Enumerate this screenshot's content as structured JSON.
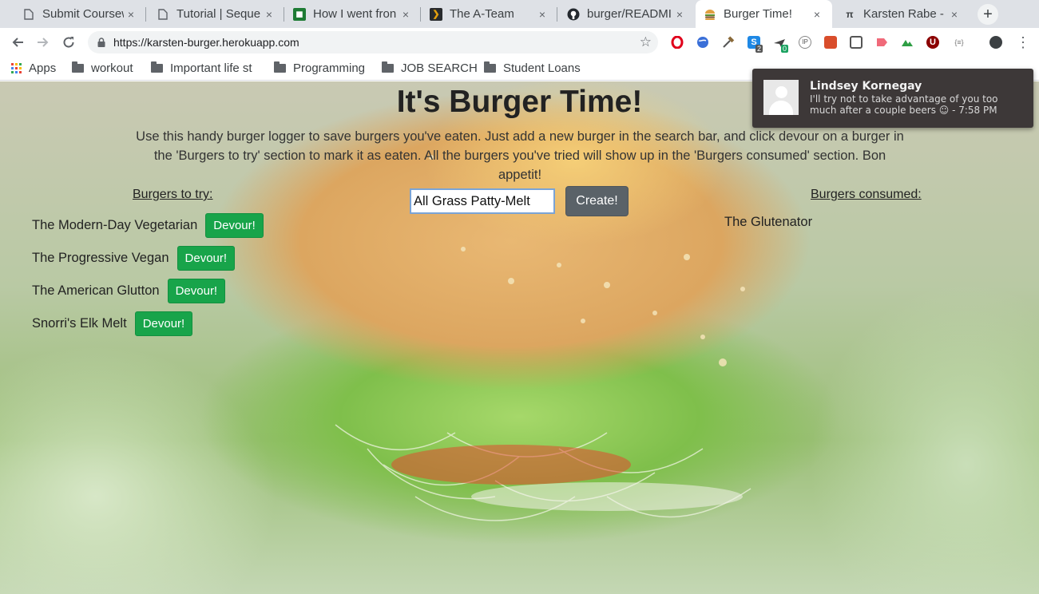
{
  "browser": {
    "tabs": [
      {
        "title": "Submit Coursew",
        "icon": "document-icon",
        "active": false
      },
      {
        "title": "Tutorial | Seque",
        "icon": "document-icon",
        "active": false
      },
      {
        "title": "How I went fron",
        "icon": "site-green-icon",
        "active": false
      },
      {
        "title": "The A-Team",
        "icon": "plex-icon",
        "active": false
      },
      {
        "title": "burger/READMI",
        "icon": "github-icon",
        "active": false
      },
      {
        "title": "Burger Time!",
        "icon": "burger-icon",
        "active": true
      },
      {
        "title": "Karsten Rabe - V",
        "icon": "pi-icon",
        "active": false
      }
    ],
    "tab_close_glyph": "×",
    "new_tab_glyph": "+",
    "url": "https://karsten-burger.herokuapp.com",
    "bookmarks": [
      "Apps",
      "workout",
      "Important life st",
      "Programming",
      "JOB SEARCH",
      "Student Loans"
    ],
    "extension_badges": {
      "s_ext": "2",
      "green_ext": "0",
      "ip_ext": "IP",
      "json_ext": "{≡}"
    }
  },
  "page": {
    "title": "It's Burger Time!",
    "intro": "Use this handy burger logger to save burgers you've eaten. Just add a new burger in the search bar, and click devour on a burger in the 'Burgers to try' section to mark it as eaten. All the burgers you've tried will show up in the 'Burgers consumed' section. Bon appetit!",
    "to_try_heading": "Burgers to try:",
    "consumed_heading": "Burgers consumed:",
    "input_value": "All Grass Patty-Melt",
    "create_label": "Create!",
    "devour_label": "Devour!",
    "to_try": [
      "The Modern-Day Vegetarian",
      "The Progressive Vegan",
      "The American Glutton",
      "Snorri's Elk Melt"
    ],
    "consumed": [
      "The Glutenator"
    ]
  },
  "notification": {
    "sender": "Lindsey Kornegay",
    "message": "I'll try not to take advantage of you too much after a couple beers ☺ - 7:58 PM"
  }
}
